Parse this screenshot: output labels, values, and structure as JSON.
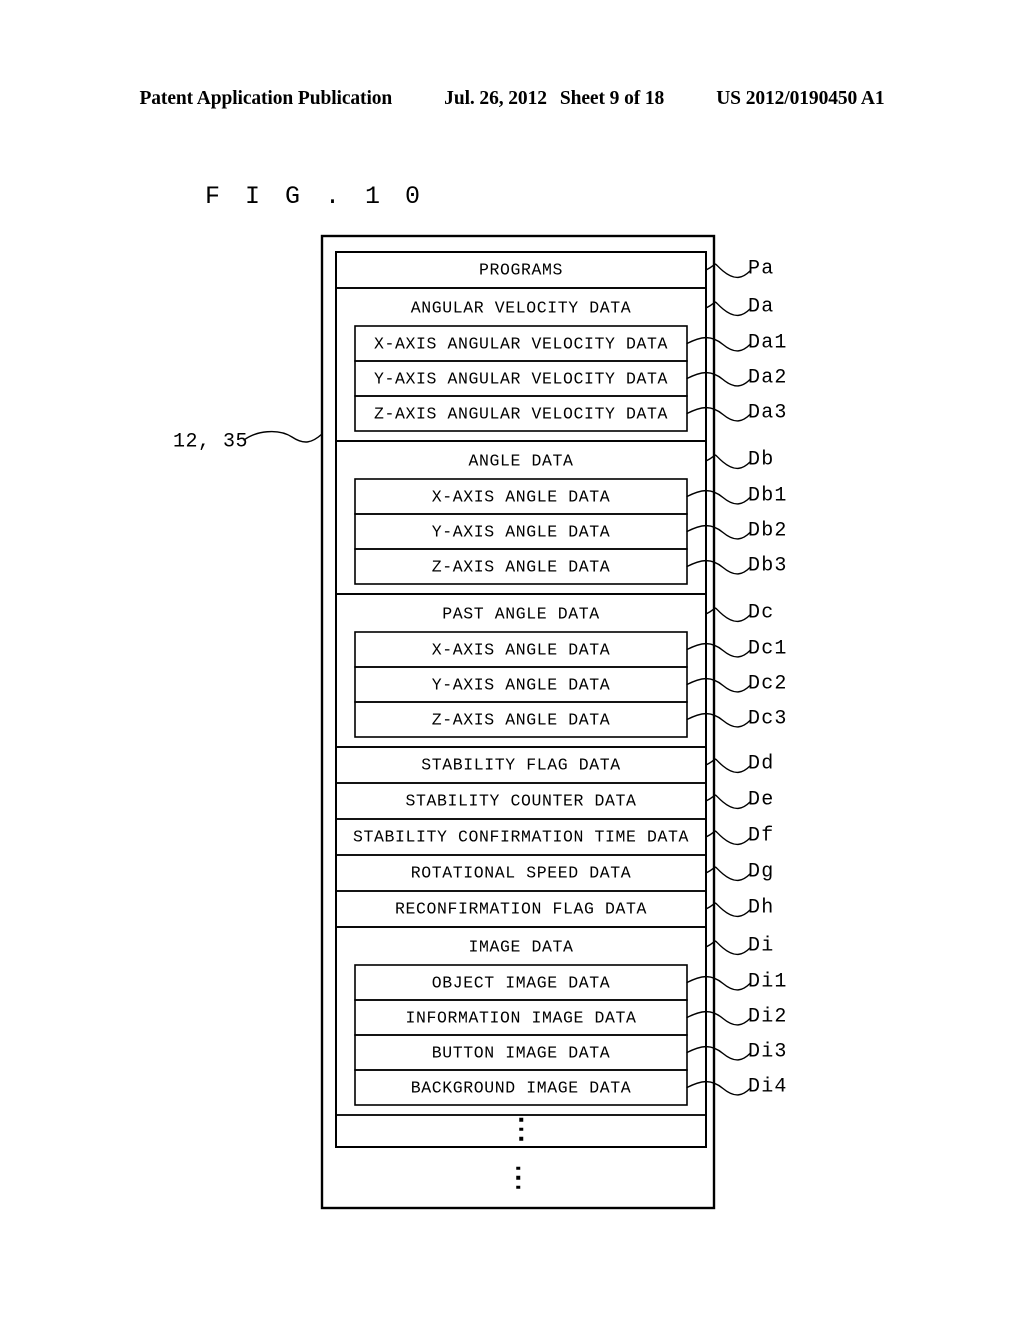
{
  "header": {
    "publication": "Patent Application Publication",
    "date": "Jul. 26, 2012",
    "sheet": "Sheet 9 of 18",
    "number": "US 2012/0190450 A1"
  },
  "figure": {
    "title": "F I G .   1 0",
    "left_reference": "12, 35"
  },
  "memory_map": {
    "rows": [
      {
        "text": "PROGRAMS",
        "ref": "Pa",
        "level": "row"
      },
      {
        "text": "ANGULAR VELOCITY DATA",
        "ref": "Da",
        "level": "group-header"
      },
      {
        "text": "X-AXIS ANGULAR VELOCITY DATA",
        "ref": "Da1",
        "level": "sub"
      },
      {
        "text": "Y-AXIS ANGULAR VELOCITY DATA",
        "ref": "Da2",
        "level": "sub"
      },
      {
        "text": "Z-AXIS ANGULAR VELOCITY DATA",
        "ref": "Da3",
        "level": "sub"
      },
      {
        "text": "ANGLE DATA",
        "ref": "Db",
        "level": "group-header"
      },
      {
        "text": "X-AXIS ANGLE DATA",
        "ref": "Db1",
        "level": "sub"
      },
      {
        "text": "Y-AXIS ANGLE DATA",
        "ref": "Db2",
        "level": "sub"
      },
      {
        "text": "Z-AXIS ANGLE DATA",
        "ref": "Db3",
        "level": "sub"
      },
      {
        "text": "PAST ANGLE DATA",
        "ref": "Dc",
        "level": "group-header"
      },
      {
        "text": "X-AXIS ANGLE DATA",
        "ref": "Dc1",
        "level": "sub"
      },
      {
        "text": "Y-AXIS ANGLE DATA",
        "ref": "Dc2",
        "level": "sub"
      },
      {
        "text": "Z-AXIS ANGLE DATA",
        "ref": "Dc3",
        "level": "sub"
      },
      {
        "text": "STABILITY FLAG DATA",
        "ref": "Dd",
        "level": "row"
      },
      {
        "text": "STABILITY COUNTER DATA",
        "ref": "De",
        "level": "row"
      },
      {
        "text": "STABILITY CONFIRMATION TIME DATA",
        "ref": "Df",
        "level": "row"
      },
      {
        "text": "ROTATIONAL SPEED DATA",
        "ref": "Dg",
        "level": "row"
      },
      {
        "text": "RECONFIRMATION FLAG DATA",
        "ref": "Dh",
        "level": "row"
      },
      {
        "text": "IMAGE DATA",
        "ref": "Di",
        "level": "group-header"
      },
      {
        "text": "OBJECT IMAGE DATA",
        "ref": "Di1",
        "level": "sub"
      },
      {
        "text": "INFORMATION IMAGE DATA",
        "ref": "Di2",
        "level": "sub"
      },
      {
        "text": "BUTTON IMAGE DATA",
        "ref": "Di3",
        "level": "sub"
      },
      {
        "text": "BACKGROUND IMAGE DATA",
        "ref": "Di4",
        "level": "sub"
      }
    ],
    "ellipsis_inner": "⋮",
    "ellipsis_outer": "⋮"
  },
  "colors": {
    "stroke": "#000000",
    "background": "#ffffff"
  }
}
